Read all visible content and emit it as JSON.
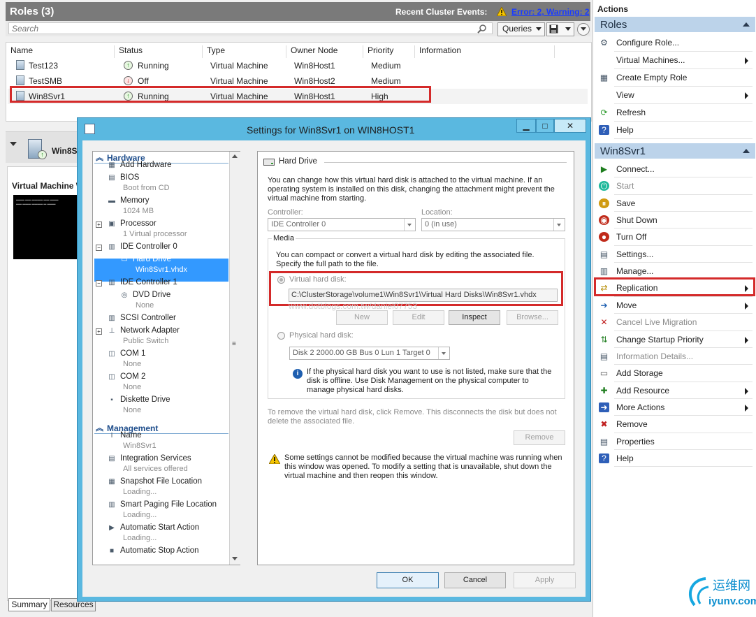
{
  "roles": {
    "title": "Roles (3)",
    "events_label": "Recent Cluster Events:",
    "events_link": "Error: 2, Warning: 2",
    "search_placeholder": "Search",
    "queries_label": "Queries",
    "columns": [
      "Name",
      "Status",
      "Type",
      "Owner Node",
      "Priority",
      "Information"
    ],
    "rows": [
      {
        "name": "Test123",
        "status": "Running",
        "type": "Virtual Machine",
        "owner": "Win8Host1",
        "priority": "Medium"
      },
      {
        "name": "TestSMB",
        "status": "Off",
        "type": "Virtual Machine",
        "owner": "Win8Host2",
        "priority": "Medium"
      },
      {
        "name": "Win8Svr1",
        "status": "Running",
        "type": "Virtual Machine",
        "owner": "Win8Host1",
        "priority": "High"
      }
    ],
    "detail_title": "Win8S",
    "vm_label": "Virtual Machine W",
    "tabs": [
      "Summary",
      "Resources"
    ]
  },
  "actions": {
    "title": "Actions",
    "sections": [
      {
        "title": "Roles",
        "items": [
          {
            "label": "Configure Role...",
            "icon": "configure-role-icon",
            "submenu": false,
            "disabled": false
          },
          {
            "label": "Virtual Machines...",
            "icon": "",
            "submenu": true,
            "disabled": false
          },
          {
            "label": "Create Empty Role",
            "icon": "create-empty-role-icon",
            "submenu": false,
            "disabled": false
          },
          {
            "label": "View",
            "icon": "",
            "submenu": true,
            "disabled": false
          },
          {
            "label": "Refresh",
            "icon": "refresh-icon",
            "submenu": false,
            "disabled": false
          },
          {
            "label": "Help",
            "icon": "help-icon",
            "submenu": false,
            "disabled": false
          }
        ]
      },
      {
        "title": "Win8Svr1",
        "items": [
          {
            "label": "Connect...",
            "icon": "connect-icon",
            "submenu": false,
            "disabled": false
          },
          {
            "label": "Start",
            "icon": "start-icon",
            "submenu": false,
            "disabled": true
          },
          {
            "label": "Save",
            "icon": "save-icon",
            "submenu": false,
            "disabled": false
          },
          {
            "label": "Shut Down",
            "icon": "shut-down-icon",
            "submenu": false,
            "disabled": false
          },
          {
            "label": "Turn Off",
            "icon": "turn-off-icon",
            "submenu": false,
            "disabled": false
          },
          {
            "label": "Settings...",
            "icon": "settings-icon",
            "submenu": false,
            "disabled": false
          },
          {
            "label": "Manage...",
            "icon": "manage-icon",
            "submenu": false,
            "disabled": false
          },
          {
            "label": "Replication",
            "icon": "replication-icon",
            "submenu": true,
            "disabled": false
          },
          {
            "label": "Move",
            "icon": "move-icon",
            "submenu": true,
            "disabled": false
          },
          {
            "label": "Cancel Live Migration",
            "icon": "cancel-migration-icon",
            "submenu": false,
            "disabled": true
          },
          {
            "label": "Change Startup Priority",
            "icon": "priority-icon",
            "submenu": true,
            "disabled": false
          },
          {
            "label": "Information Details...",
            "icon": "information-icon",
            "submenu": false,
            "disabled": true
          },
          {
            "label": "Add Storage",
            "icon": "add-storage-icon",
            "submenu": false,
            "disabled": false
          },
          {
            "label": "Add Resource",
            "icon": "add-resource-icon",
            "submenu": true,
            "disabled": false
          },
          {
            "label": "More Actions",
            "icon": "more-actions-icon",
            "submenu": true,
            "disabled": false
          },
          {
            "label": "Remove",
            "icon": "remove-icon",
            "submenu": false,
            "disabled": false
          },
          {
            "label": "Properties",
            "icon": "properties-icon",
            "submenu": false,
            "disabled": false
          },
          {
            "label": "Help",
            "icon": "help-icon",
            "submenu": false,
            "disabled": false
          }
        ]
      }
    ]
  },
  "dialog": {
    "title": "Settings for Win8Svr1 on WIN8HOST1",
    "tree": {
      "hardware_label": "Hardware",
      "management_label": "Management",
      "items": [
        {
          "label": "Add Hardware",
          "sub": "",
          "icon": "add-hardware-icon"
        },
        {
          "label": "BIOS",
          "sub": "Boot from CD",
          "icon": "bios-icon"
        },
        {
          "label": "Memory",
          "sub": "1024 MB",
          "icon": "memory-icon"
        },
        {
          "label": "Processor",
          "sub": "1 Virtual processor",
          "icon": "processor-icon"
        },
        {
          "label": "IDE Controller 0",
          "sub": "",
          "icon": "ide-controller-icon"
        },
        {
          "label": "Hard Drive",
          "sub": "Win8Svr1.vhdx",
          "icon": "hard-drive-icon"
        },
        {
          "label": "IDE Controller 1",
          "sub": "",
          "icon": "ide-controller-icon"
        },
        {
          "label": "DVD Drive",
          "sub": "None",
          "icon": "dvd-drive-icon"
        },
        {
          "label": "SCSI Controller",
          "sub": "",
          "icon": "scsi-controller-icon"
        },
        {
          "label": "Network Adapter",
          "sub": "Public Switch",
          "icon": "network-adapter-icon"
        },
        {
          "label": "COM 1",
          "sub": "None",
          "icon": "com-port-icon"
        },
        {
          "label": "COM 2",
          "sub": "None",
          "icon": "com-port-icon"
        },
        {
          "label": "Diskette Drive",
          "sub": "None",
          "icon": "diskette-icon"
        },
        {
          "label": "Name",
          "sub": "Win8Svr1",
          "icon": "name-icon"
        },
        {
          "label": "Integration Services",
          "sub": "All services offered",
          "icon": "integration-icon"
        },
        {
          "label": "Snapshot File Location",
          "sub": "Loading...",
          "icon": "snapshot-icon"
        },
        {
          "label": "Smart Paging File Location",
          "sub": "Loading...",
          "icon": "paging-icon"
        },
        {
          "label": "Automatic Start Action",
          "sub": "Loading...",
          "icon": "auto-start-icon"
        },
        {
          "label": "Automatic Stop Action",
          "sub": "",
          "icon": "auto-stop-icon"
        }
      ]
    },
    "pane": {
      "section_title": "Hard Drive",
      "intro": "You can change how this virtual hard disk is attached to the virtual machine. If an operating system is installed on this disk, changing the attachment might prevent the virtual machine from starting.",
      "controller_label": "Controller:",
      "controller_value": "IDE Controller 0",
      "location_label": "Location:",
      "location_value": "0 (in use)",
      "media_label": "Media",
      "media_text": "You can compact or convert a virtual hard disk by editing the associated file. Specify the full path to the file.",
      "vhd_label": "Virtual hard disk:",
      "vhd_path": "C:\\ClusterStorage\\volume1\\Win8Svr1\\Virtual Hard Disks\\Win8Svr1.vhdx",
      "watermark": "www.dotblogs.com.tw/daniel07753",
      "btn_new": "New",
      "btn_edit": "Edit",
      "btn_inspect": "Inspect",
      "btn_browse": "Browse...",
      "phys_label": "Physical hard disk:",
      "phys_value": "Disk 2 2000.00 GB Bus 0 Lun 1 Target 0",
      "phys_info": "If the physical hard disk you want to use is not listed, make sure that the disk is offline. Use Disk Management on the physical computer to manage physical hard disks.",
      "remove_text": "To remove the virtual hard disk, click Remove. This disconnects the disk but does not delete the associated file.",
      "btn_remove": "Remove",
      "warning_text": "Some settings cannot be modified because the virtual machine was running when this window was opened. To modify a setting that is unavailable, shut down the virtual machine and then reopen this window."
    },
    "btn_ok": "OK",
    "btn_cancel": "Cancel",
    "btn_apply": "Apply"
  },
  "branding": {
    "logo_text": "运维网",
    "logo_url": "iyunv.com"
  },
  "colors": {
    "accent_red": "#d42a2a",
    "dialog_frame": "#5ab8e0",
    "selection": "#3399ff",
    "section_header": "#bcd3ea"
  }
}
